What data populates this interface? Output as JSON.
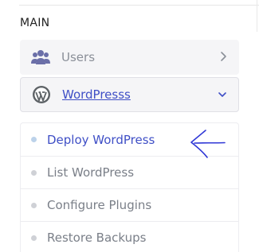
{
  "sidebar": {
    "section_heading": "MAIN",
    "items": [
      {
        "label": "Users",
        "icon": "users-icon",
        "chevron": "chevron-right-icon"
      },
      {
        "label": "WordPresss",
        "icon": "wordpress-icon",
        "chevron": "chevron-down-icon"
      }
    ],
    "submenu": [
      {
        "label": "Deploy WordPress",
        "active": true
      },
      {
        "label": "List WordPress",
        "active": false
      },
      {
        "label": "Configure Plugins",
        "active": false
      },
      {
        "label": "Restore Backups",
        "active": false
      }
    ]
  },
  "annotation": {
    "type": "hand-drawn-arrow",
    "color": "#2f37d6",
    "points_to": "Deploy WordPress"
  },
  "colors": {
    "accent": "#3f4fc6",
    "muted_text": "#7a7f88",
    "item_bg": "#f5f5f7",
    "border": "#e0e0e6"
  }
}
